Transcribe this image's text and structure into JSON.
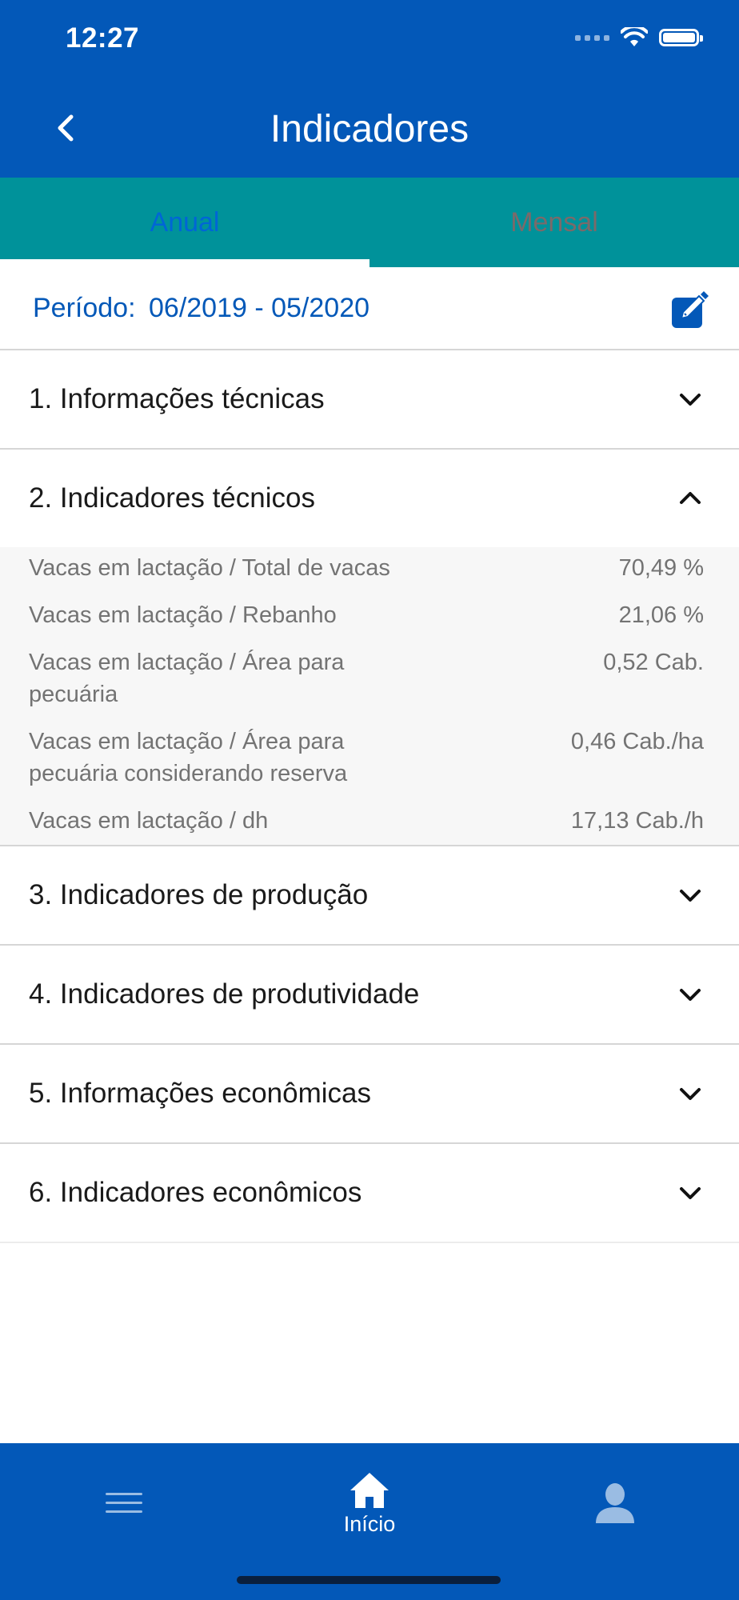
{
  "status_bar": {
    "time": "12:27"
  },
  "header": {
    "title": "Indicadores"
  },
  "tabs": [
    {
      "label": "Anual",
      "active": true
    },
    {
      "label": "Mensal",
      "active": false
    }
  ],
  "period": {
    "label": "Período:",
    "value": "06/2019 - 05/2020"
  },
  "sections": [
    {
      "title": "1. Informações técnicas",
      "expanded": false
    },
    {
      "title": "2. Indicadores técnicos",
      "expanded": true,
      "rows": [
        {
          "label": "Vacas em lactação / Total de vacas",
          "value": "70,49 %"
        },
        {
          "label": "Vacas em lactação / Rebanho",
          "value": "21,06 %"
        },
        {
          "label": "Vacas em lactação / Área para pecuária",
          "value": "0,52 Cab."
        },
        {
          "label": "Vacas em lactação / Área para pecuária considerando reserva",
          "value": "0,46 Cab./ha"
        },
        {
          "label": "Vacas em lactação / dh",
          "value": "17,13 Cab./h"
        }
      ]
    },
    {
      "title": "3. Indicadores de produção",
      "expanded": false
    },
    {
      "title": "4. Indicadores de produtividade",
      "expanded": false
    },
    {
      "title": "5. Informações econômicas",
      "expanded": false
    },
    {
      "title": "6. Indicadores econômicos",
      "expanded": false
    }
  ],
  "bottom_nav": {
    "menu_icon": "hamburger-icon",
    "home": {
      "label": "Início",
      "icon": "home-icon"
    },
    "profile_icon": "user-icon"
  },
  "colors": {
    "primary": "#0358b8",
    "tab_bar": "#00929a",
    "expanded_bg": "#f7f7f7"
  }
}
